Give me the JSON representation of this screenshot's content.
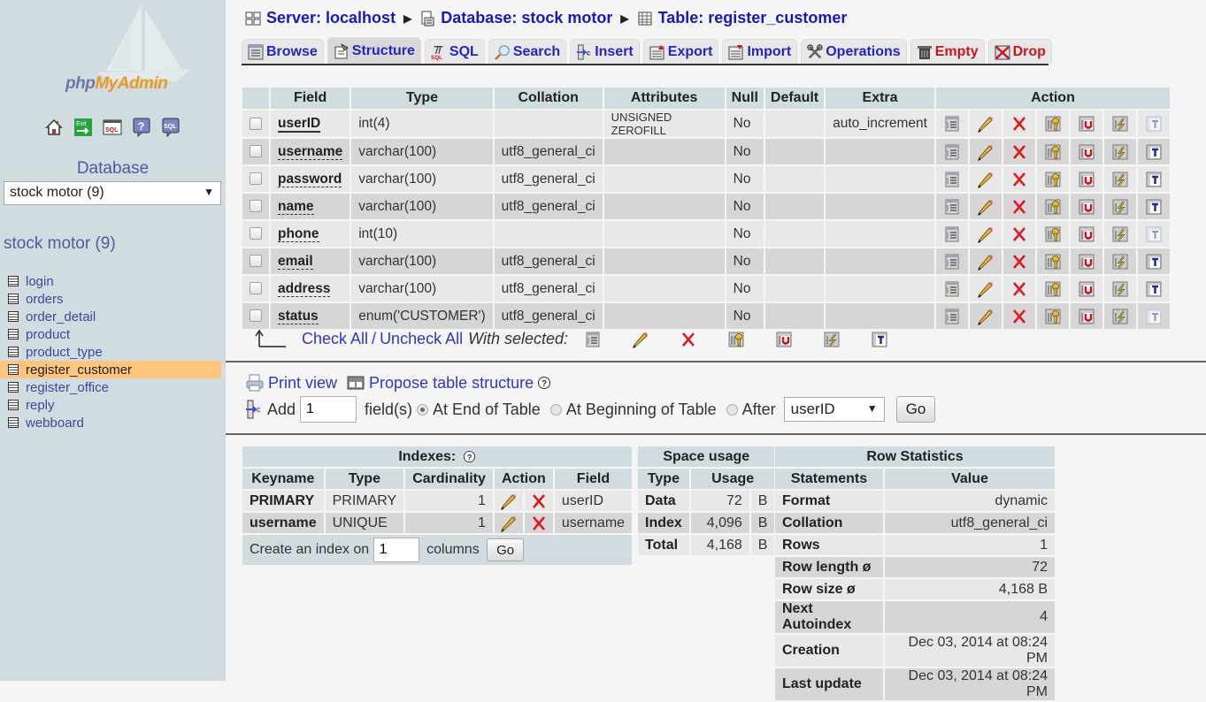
{
  "sidebar": {
    "logo": {
      "php": "php",
      "myadmin": "MyAdmin"
    },
    "nav_icons": [
      "home-icon",
      "exit-icon",
      "sql-query-icon",
      "help-icon",
      "sql-docs-icon"
    ],
    "database_label": "Database",
    "database_select": "stock motor (9)",
    "database_title": "stock motor (9)",
    "tables": [
      {
        "name": "login",
        "active": false
      },
      {
        "name": "orders",
        "active": false
      },
      {
        "name": "order_detail",
        "active": false
      },
      {
        "name": "product",
        "active": false
      },
      {
        "name": "product_type",
        "active": false
      },
      {
        "name": "register_customer",
        "active": true
      },
      {
        "name": "register_office",
        "active": false
      },
      {
        "name": "reply",
        "active": false
      },
      {
        "name": "webboard",
        "active": false
      }
    ]
  },
  "breadcrumb": {
    "server": "Server: localhost",
    "database": "Database: stock motor",
    "table": "Table: register_customer"
  },
  "tabs": [
    {
      "label": "Browse",
      "icon": "browse-icon",
      "active": false,
      "danger": false
    },
    {
      "label": "Structure",
      "icon": "structure-icon",
      "active": true,
      "danger": false
    },
    {
      "label": "SQL",
      "icon": "sql-icon",
      "active": false,
      "danger": false
    },
    {
      "label": "Search",
      "icon": "search-icon",
      "active": false,
      "danger": false
    },
    {
      "label": "Insert",
      "icon": "insert-icon",
      "active": false,
      "danger": false
    },
    {
      "label": "Export",
      "icon": "export-icon",
      "active": false,
      "danger": false
    },
    {
      "label": "Import",
      "icon": "import-icon",
      "active": false,
      "danger": false
    },
    {
      "label": "Operations",
      "icon": "operations-icon",
      "active": false,
      "danger": false
    },
    {
      "label": "Empty",
      "icon": "empty-icon",
      "active": false,
      "danger": true
    },
    {
      "label": "Drop",
      "icon": "drop-icon",
      "active": false,
      "danger": true
    }
  ],
  "structure": {
    "headers": [
      "",
      "Field",
      "Type",
      "Collation",
      "Attributes",
      "Null",
      "Default",
      "Extra",
      "Action"
    ],
    "rows": [
      {
        "field": "userID",
        "type": "int(4)",
        "collation": "",
        "attributes": "UNSIGNED ZEROFILL",
        "null": "No",
        "default": "",
        "extra": "auto_increment",
        "primary": true,
        "fulltext_enabled": false
      },
      {
        "field": "username",
        "type": "varchar(100)",
        "collation": "utf8_general_ci",
        "attributes": "",
        "null": "No",
        "default": "",
        "extra": "",
        "primary": false,
        "fulltext_enabled": true
      },
      {
        "field": "password",
        "type": "varchar(100)",
        "collation": "utf8_general_ci",
        "attributes": "",
        "null": "No",
        "default": "",
        "extra": "",
        "primary": false,
        "fulltext_enabled": true
      },
      {
        "field": "name",
        "type": "varchar(100)",
        "collation": "utf8_general_ci",
        "attributes": "",
        "null": "No",
        "default": "",
        "extra": "",
        "primary": false,
        "fulltext_enabled": true
      },
      {
        "field": "phone",
        "type": "int(10)",
        "collation": "",
        "attributes": "",
        "null": "No",
        "default": "",
        "extra": "",
        "primary": false,
        "fulltext_enabled": false
      },
      {
        "field": "email",
        "type": "varchar(100)",
        "collation": "utf8_general_ci",
        "attributes": "",
        "null": "No",
        "default": "",
        "extra": "",
        "primary": false,
        "fulltext_enabled": true
      },
      {
        "field": "address",
        "type": "varchar(100)",
        "collation": "utf8_general_ci",
        "attributes": "",
        "null": "No",
        "default": "",
        "extra": "",
        "primary": false,
        "fulltext_enabled": true
      },
      {
        "field": "status",
        "type": "enum('CUSTOMER')",
        "collation": "utf8_general_ci",
        "attributes": "",
        "null": "No",
        "default": "",
        "extra": "",
        "primary": false,
        "fulltext_enabled": false
      }
    ],
    "row_actions": [
      "browse-distinct-icon",
      "edit-icon",
      "drop-icon",
      "primary-key-icon",
      "unique-icon",
      "index-icon",
      "fulltext-icon"
    ]
  },
  "bulk": {
    "check_all": "Check All",
    "separator": "/",
    "uncheck_all": "Uncheck All",
    "with_selected": "With selected:"
  },
  "tools": {
    "print_view": "Print view",
    "propose_structure": "Propose table structure",
    "add_label": "Add",
    "add_count": "1",
    "fields_label": "field(s)",
    "at_end": "At End of Table",
    "at_beginning": "At Beginning of Table",
    "after": "After",
    "after_column": "userID",
    "position_selected": "end",
    "go": "Go"
  },
  "indexes": {
    "title": "Indexes:",
    "headers": [
      "Keyname",
      "Type",
      "Cardinality",
      "Action",
      "Field"
    ],
    "rows": [
      {
        "keyname": "PRIMARY",
        "type": "PRIMARY",
        "cardinality": "1",
        "field": "userID"
      },
      {
        "keyname": "username",
        "type": "UNIQUE",
        "cardinality": "1",
        "field": "username"
      }
    ],
    "create_prefix": "Create an index on",
    "create_count": "1",
    "create_suffix": "columns",
    "go": "Go"
  },
  "space_usage": {
    "title": "Space usage",
    "headers": [
      "Type",
      "Usage"
    ],
    "rows": [
      {
        "type": "Data",
        "value": "72",
        "unit": "B"
      },
      {
        "type": "Index",
        "value": "4,096",
        "unit": "B"
      },
      {
        "type": "Total",
        "value": "4,168",
        "unit": "B"
      }
    ]
  },
  "row_statistics": {
    "title": "Row Statistics",
    "headers": [
      "Statements",
      "Value"
    ],
    "rows": [
      {
        "label": "Format",
        "value": "dynamic"
      },
      {
        "label": "Collation",
        "value": "utf8_general_ci"
      },
      {
        "label": "Rows",
        "value": "1"
      },
      {
        "label": "Row length ø",
        "value": "72"
      },
      {
        "label": "Row size ø",
        "value": "4,168 B"
      },
      {
        "label": "Next Autoindex",
        "value": "4"
      },
      {
        "label": "Creation",
        "value": "Dec 03, 2014 at 08:24 PM"
      },
      {
        "label": "Last update",
        "value": "Dec 03, 2014 at 08:24 PM"
      }
    ]
  }
}
